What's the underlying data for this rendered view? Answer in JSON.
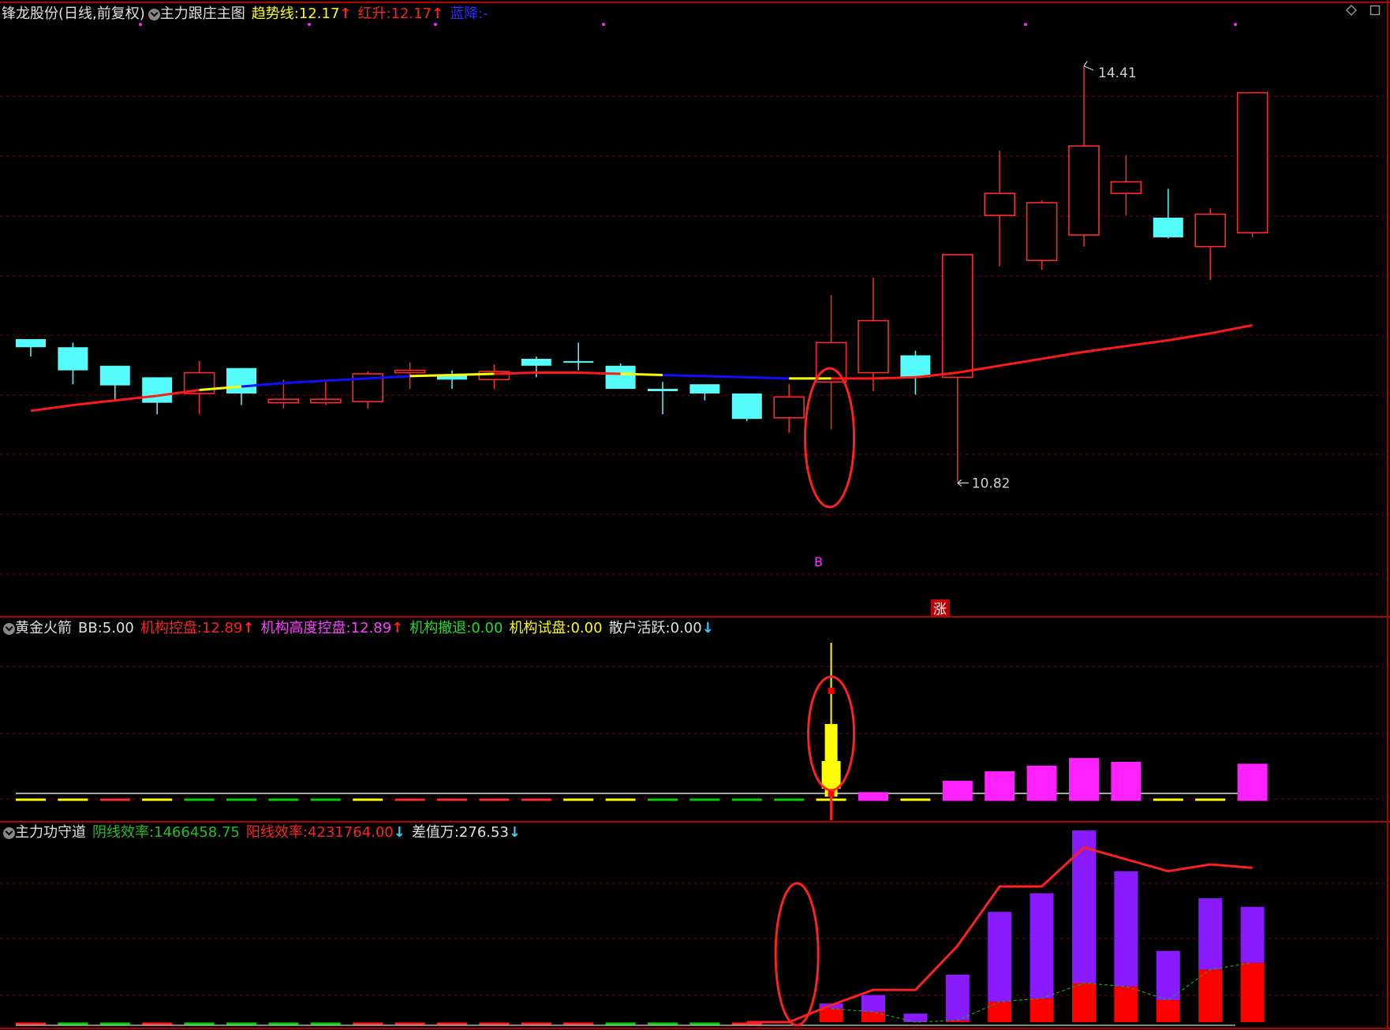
{
  "main_panel": {
    "stock_title": "锋龙股份(日线,前复权)",
    "indicator_name": "主力跟庄主图",
    "values": [
      {
        "label": "趋势线:",
        "value": "12.17",
        "arrow": "↑",
        "label_color": "#ffff00",
        "value_color": "#ffff00",
        "arrow_color": "#ff2020"
      },
      {
        "label": "红升:",
        "value": "12.17",
        "arrow": "↑",
        "label_color": "#ff2020",
        "value_color": "#ff2020",
        "arrow_color": "#ff2020"
      },
      {
        "label": "蓝降:",
        "value": "-",
        "arrow": "",
        "label_color": "#2a2aff",
        "value_color": "#2a2aff",
        "arrow_color": "#2a2aff"
      }
    ],
    "annotations": {
      "high": "14.41",
      "low": "10.82",
      "buy_mark": "B",
      "rise_mark": "涨"
    }
  },
  "rocket_panel": {
    "indicator_name": "黄金火箭",
    "values": [
      {
        "label": "BB:",
        "value": "5.00",
        "arrow": "",
        "label_color": "#e0e0e0",
        "value_color": "#e0e0e0",
        "arrow_color": "#e0e0e0"
      },
      {
        "label": "机构控盘:",
        "value": "12.89",
        "arrow": "↑",
        "label_color": "#ff2020",
        "value_color": "#ff2020",
        "arrow_color": "#ff2020"
      },
      {
        "label": "机构高度控盘:",
        "value": "12.89",
        "arrow": "↑",
        "label_color": "#ff40ff",
        "value_color": "#ff40ff",
        "arrow_color": "#ff2020"
      },
      {
        "label": "机构撤退:",
        "value": "0.00",
        "arrow": "",
        "label_color": "#20e020",
        "value_color": "#20e020",
        "arrow_color": "#20e020"
      },
      {
        "label": "机构试盘:",
        "value": "0.00",
        "arrow": "",
        "label_color": "#ffff00",
        "value_color": "#ffff00",
        "arrow_color": "#ffff00"
      },
      {
        "label": "散户活跃:",
        "value": "0.00",
        "arrow": "↓",
        "label_color": "#e0e0e0",
        "value_color": "#e0e0e0",
        "arrow_color": "#30d0ff"
      }
    ]
  },
  "defense_panel": {
    "indicator_name": "主力功守道",
    "values": [
      {
        "label": "阴线效率:",
        "value": "1466458.75",
        "arrow": "",
        "label_color": "#20c020",
        "value_color": "#20c020",
        "arrow_color": "#20c020"
      },
      {
        "label": "阳线效率:",
        "value": "4231764.00",
        "arrow": "↓",
        "label_color": "#ff2020",
        "value_color": "#ff2020",
        "arrow_color": "#30d0ff"
      },
      {
        "label": "差值万:",
        "value": "276.53",
        "arrow": "↓",
        "label_color": "#e0e0e0",
        "value_color": "#e0e0e0",
        "arrow_color": "#30d0ff"
      }
    ]
  },
  "colors": {
    "up": "#ff2a2a",
    "down": "#54fcfc",
    "grid": "#7a0000",
    "border": "#b00000",
    "trend_red": "#ff1a1a",
    "trend_blue": "#1010ff",
    "trend_yellow": "#ffff00",
    "magenta": "#ff20ff",
    "purple": "#8a1aff",
    "yellow": "#ffff00",
    "green": "#00d000"
  },
  "chart_data": {
    "type": "candlestick",
    "price_range": [
      10.4,
      14.6
    ],
    "candles": [
      {
        "o": 12.05,
        "c": 11.98,
        "h": 12.05,
        "l": 11.9
      },
      {
        "o": 11.98,
        "c": 11.78,
        "h": 12.02,
        "l": 11.66
      },
      {
        "o": 11.82,
        "c": 11.65,
        "h": 11.82,
        "l": 11.52
      },
      {
        "o": 11.72,
        "c": 11.5,
        "h": 11.72,
        "l": 11.4
      },
      {
        "o": 11.58,
        "c": 11.76,
        "h": 11.86,
        "l": 11.4
      },
      {
        "o": 11.8,
        "c": 11.58,
        "h": 11.8,
        "l": 11.48
      },
      {
        "o": 11.5,
        "c": 11.53,
        "h": 11.7,
        "l": 11.45
      },
      {
        "o": 11.5,
        "c": 11.53,
        "h": 11.68,
        "l": 11.48
      },
      {
        "o": 11.51,
        "c": 11.75,
        "h": 11.77,
        "l": 11.45
      },
      {
        "o": 11.76,
        "c": 11.78,
        "h": 11.85,
        "l": 11.62
      },
      {
        "o": 11.74,
        "c": 11.7,
        "h": 11.78,
        "l": 11.62
      },
      {
        "o": 11.7,
        "c": 11.77,
        "h": 11.83,
        "l": 11.62
      },
      {
        "o": 11.88,
        "c": 11.82,
        "h": 11.9,
        "l": 11.72
      },
      {
        "o": 11.86,
        "c": 11.85,
        "h": 12.02,
        "l": 11.78
      },
      {
        "o": 11.82,
        "c": 11.62,
        "h": 11.84,
        "l": 11.62
      },
      {
        "o": 11.62,
        "c": 11.6,
        "h": 11.68,
        "l": 11.4
      },
      {
        "o": 11.66,
        "c": 11.58,
        "h": 11.66,
        "l": 11.52
      },
      {
        "o": 11.58,
        "c": 11.36,
        "h": 11.58,
        "l": 11.34
      },
      {
        "o": 11.37,
        "c": 11.55,
        "h": 11.66,
        "l": 11.24
      },
      {
        "o": 11.68,
        "c": 12.02,
        "h": 12.43,
        "l": 11.27
      },
      {
        "o": 11.76,
        "c": 12.21,
        "h": 12.58,
        "l": 11.6
      },
      {
        "o": 11.91,
        "c": 11.72,
        "h": 11.95,
        "l": 11.57
      },
      {
        "o": 11.72,
        "c": 12.78,
        "h": 12.78,
        "l": 10.82
      },
      {
        "o": 13.12,
        "c": 13.31,
        "h": 13.68,
        "l": 12.68
      },
      {
        "o": 12.73,
        "c": 13.23,
        "h": 13.25,
        "l": 12.65
      },
      {
        "o": 12.95,
        "c": 13.72,
        "h": 14.41,
        "l": 12.85
      },
      {
        "o": 13.31,
        "c": 13.41,
        "h": 13.64,
        "l": 13.12
      },
      {
        "o": 13.1,
        "c": 12.93,
        "h": 13.35,
        "l": 12.92
      },
      {
        "o": 12.85,
        "c": 13.13,
        "h": 13.18,
        "l": 12.56
      },
      {
        "o": 12.97,
        "c": 14.18,
        "h": 14.18,
        "l": 12.93
      }
    ],
    "trend_line": [
      11.43,
      11.48,
      11.52,
      11.56,
      11.61,
      11.64,
      11.67,
      11.69,
      11.71,
      11.73,
      11.74,
      11.75,
      11.76,
      11.76,
      11.75,
      11.74,
      11.73,
      11.72,
      11.71,
      11.71,
      11.71,
      11.72,
      11.76,
      11.82,
      11.88,
      11.94,
      11.99,
      12.04,
      12.1,
      12.17
    ],
    "trend_segments": [
      "red",
      "red",
      "red",
      "red",
      "red",
      "yellow",
      "blue",
      "blue",
      "blue",
      "blue",
      "yellow",
      "yellow",
      "red",
      "red",
      "red",
      "yellow",
      "blue",
      "blue",
      "blue",
      "yellow",
      "red",
      "red",
      "red",
      "red",
      "red",
      "red",
      "red",
      "red",
      "red",
      "red"
    ],
    "rocket_bars": [
      0,
      0,
      0,
      0,
      0,
      0,
      0,
      0,
      0,
      0,
      0,
      0,
      0,
      0,
      0,
      0,
      0,
      0,
      0,
      10.0,
      0.4,
      0,
      1.0,
      1.5,
      1.8,
      2.2,
      2.0,
      0,
      0,
      1.9
    ],
    "rocket_dash_colors": [
      "yellow",
      "yellow",
      "red",
      "yellow",
      "green",
      "green",
      "green",
      "green",
      "yellow",
      "red",
      "red",
      "red",
      "red",
      "yellow",
      "yellow",
      "green",
      "green",
      "green",
      "green",
      "yellow",
      "magenta",
      "yellow",
      "magenta",
      "magenta",
      "magenta",
      "magenta",
      "magenta",
      "yellow",
      "yellow",
      "magenta"
    ],
    "defense_purple": [
      0,
      0,
      0,
      0,
      0,
      0,
      0,
      0,
      0,
      0,
      0,
      0,
      0,
      0,
      0,
      0,
      0,
      0,
      0,
      0.3,
      1.0,
      0.5,
      2.7,
      5.3,
      6.2,
      9.0,
      6.8,
      2.9,
      4.2,
      3.3
    ],
    "defense_red": [
      0,
      0,
      0,
      0,
      0,
      0,
      0,
      0,
      0,
      0,
      0,
      0,
      0,
      0,
      0,
      0,
      0,
      0,
      0,
      0.8,
      0.6,
      0,
      0.1,
      1.2,
      1.4,
      2.3,
      2.1,
      1.3,
      3.1,
      3.5
    ],
    "defense_line": [
      0,
      0,
      0,
      0,
      0,
      0,
      0,
      0,
      0,
      0,
      0,
      0,
      0,
      0,
      0,
      0,
      0,
      0,
      0,
      1.0,
      1.9,
      1.9,
      4.5,
      8.0,
      8.0,
      10.3,
      9.6,
      8.9,
      9.3,
      9.1
    ]
  }
}
